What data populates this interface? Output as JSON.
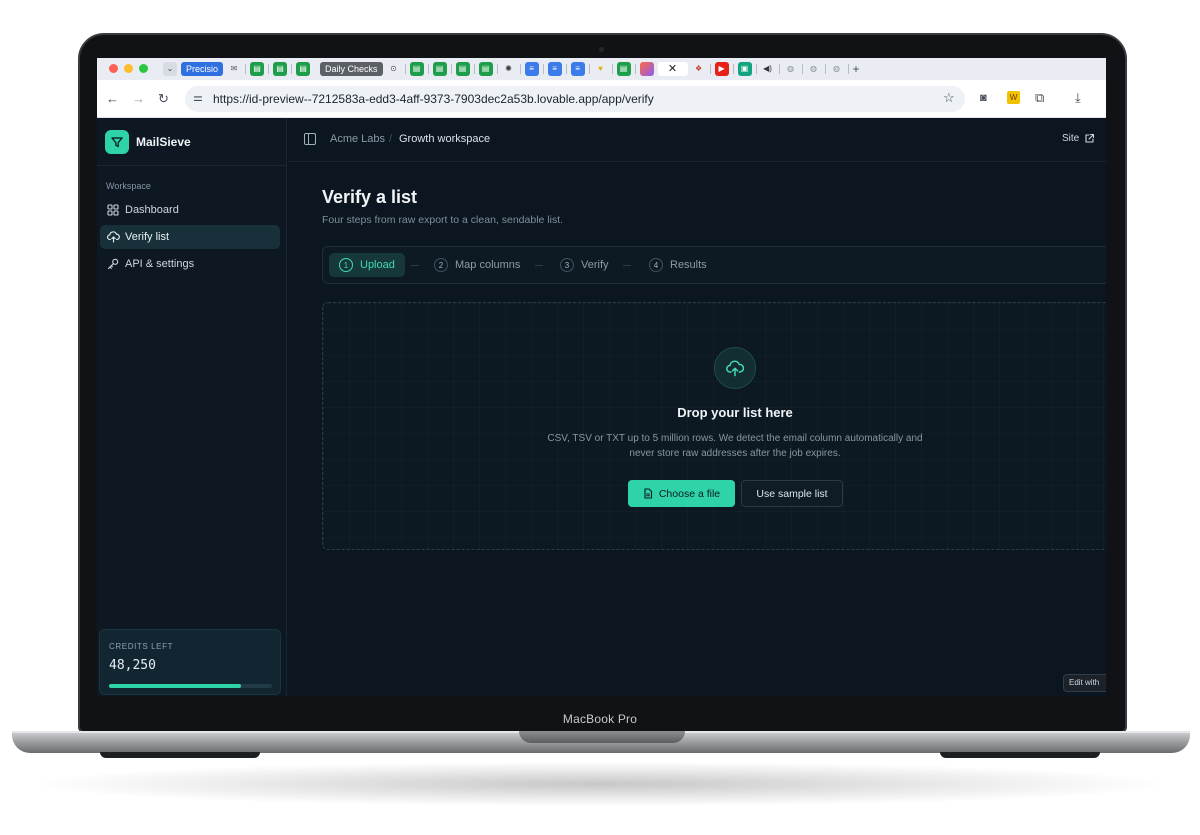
{
  "device": {
    "label": "MacBook Pro"
  },
  "browser": {
    "tabs": [
      {
        "label": "Precisio",
        "color": "#2f6fe0"
      },
      {
        "label": "Daily Checks",
        "color": "#5b5f66"
      }
    ],
    "tab_icons": [
      "gmail-icon",
      "sheets-icon",
      "docs-icon",
      "youtube-icon",
      "chrome-icon"
    ],
    "url": "https://id-preview--7212583a-edd3-4aff-9373-7903dec2a53b.lovable.app/app/verify",
    "accent": "#2fd3a8"
  },
  "app": {
    "brand": "MailSieve",
    "sidebar": {
      "section_label": "Workspace",
      "items": [
        {
          "label": "Dashboard",
          "icon": "grid-icon"
        },
        {
          "label": "Verify list",
          "icon": "cloud-upload-icon",
          "active": true
        },
        {
          "label": "API & settings",
          "icon": "key-icon"
        }
      ],
      "credits": {
        "label": "CREDITS LEFT",
        "value": "48,250",
        "progress": 0.81
      }
    },
    "topbar": {
      "breadcrumb": [
        "Acme Labs",
        "Growth workspace"
      ],
      "site_link": "Site"
    },
    "page": {
      "title": "Verify a list",
      "subtitle": "Four steps from raw export to a clean, sendable list."
    },
    "steps": [
      {
        "num": "1",
        "label": "Upload",
        "active": true
      },
      {
        "num": "2",
        "label": "Map columns"
      },
      {
        "num": "3",
        "label": "Verify"
      },
      {
        "num": "4",
        "label": "Results"
      }
    ],
    "dropzone": {
      "title": "Drop your list here",
      "description": "CSV, TSV or TXT up to 5 million rows. We detect the email column automatically and never store raw addresses after the job expires.",
      "primary_button": "Choose a file",
      "secondary_button": "Use sample list"
    },
    "edit_badge": "Edit with"
  }
}
